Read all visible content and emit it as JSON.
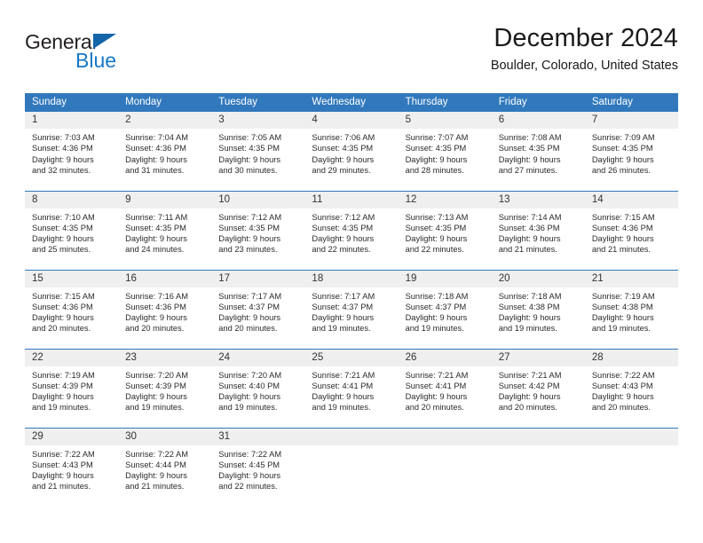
{
  "logo": {
    "word1": "General",
    "word2": "Blue",
    "triangle_color": "#1464aa",
    "blue_color": "#1878c8"
  },
  "header": {
    "title": "December 2024",
    "subtitle": "Boulder, Colorado, United States"
  },
  "theme": {
    "header_row_bg": "#3179bc",
    "daynum_bg": "#efefef",
    "grid_line": "#3179bc",
    "text": "#2b2b2b"
  },
  "weekday_headers": [
    "Sunday",
    "Monday",
    "Tuesday",
    "Wednesday",
    "Thursday",
    "Friday",
    "Saturday"
  ],
  "weeks": [
    [
      {
        "day": "1",
        "sunrise": "Sunrise: 7:03 AM",
        "sunset": "Sunset: 4:36 PM",
        "daylight1": "Daylight: 9 hours",
        "daylight2": "and 32 minutes."
      },
      {
        "day": "2",
        "sunrise": "Sunrise: 7:04 AM",
        "sunset": "Sunset: 4:36 PM",
        "daylight1": "Daylight: 9 hours",
        "daylight2": "and 31 minutes."
      },
      {
        "day": "3",
        "sunrise": "Sunrise: 7:05 AM",
        "sunset": "Sunset: 4:35 PM",
        "daylight1": "Daylight: 9 hours",
        "daylight2": "and 30 minutes."
      },
      {
        "day": "4",
        "sunrise": "Sunrise: 7:06 AM",
        "sunset": "Sunset: 4:35 PM",
        "daylight1": "Daylight: 9 hours",
        "daylight2": "and 29 minutes."
      },
      {
        "day": "5",
        "sunrise": "Sunrise: 7:07 AM",
        "sunset": "Sunset: 4:35 PM",
        "daylight1": "Daylight: 9 hours",
        "daylight2": "and 28 minutes."
      },
      {
        "day": "6",
        "sunrise": "Sunrise: 7:08 AM",
        "sunset": "Sunset: 4:35 PM",
        "daylight1": "Daylight: 9 hours",
        "daylight2": "and 27 minutes."
      },
      {
        "day": "7",
        "sunrise": "Sunrise: 7:09 AM",
        "sunset": "Sunset: 4:35 PM",
        "daylight1": "Daylight: 9 hours",
        "daylight2": "and 26 minutes."
      }
    ],
    [
      {
        "day": "8",
        "sunrise": "Sunrise: 7:10 AM",
        "sunset": "Sunset: 4:35 PM",
        "daylight1": "Daylight: 9 hours",
        "daylight2": "and 25 minutes."
      },
      {
        "day": "9",
        "sunrise": "Sunrise: 7:11 AM",
        "sunset": "Sunset: 4:35 PM",
        "daylight1": "Daylight: 9 hours",
        "daylight2": "and 24 minutes."
      },
      {
        "day": "10",
        "sunrise": "Sunrise: 7:12 AM",
        "sunset": "Sunset: 4:35 PM",
        "daylight1": "Daylight: 9 hours",
        "daylight2": "and 23 minutes."
      },
      {
        "day": "11",
        "sunrise": "Sunrise: 7:12 AM",
        "sunset": "Sunset: 4:35 PM",
        "daylight1": "Daylight: 9 hours",
        "daylight2": "and 22 minutes."
      },
      {
        "day": "12",
        "sunrise": "Sunrise: 7:13 AM",
        "sunset": "Sunset: 4:35 PM",
        "daylight1": "Daylight: 9 hours",
        "daylight2": "and 22 minutes."
      },
      {
        "day": "13",
        "sunrise": "Sunrise: 7:14 AM",
        "sunset": "Sunset: 4:36 PM",
        "daylight1": "Daylight: 9 hours",
        "daylight2": "and 21 minutes."
      },
      {
        "day": "14",
        "sunrise": "Sunrise: 7:15 AM",
        "sunset": "Sunset: 4:36 PM",
        "daylight1": "Daylight: 9 hours",
        "daylight2": "and 21 minutes."
      }
    ],
    [
      {
        "day": "15",
        "sunrise": "Sunrise: 7:15 AM",
        "sunset": "Sunset: 4:36 PM",
        "daylight1": "Daylight: 9 hours",
        "daylight2": "and 20 minutes."
      },
      {
        "day": "16",
        "sunrise": "Sunrise: 7:16 AM",
        "sunset": "Sunset: 4:36 PM",
        "daylight1": "Daylight: 9 hours",
        "daylight2": "and 20 minutes."
      },
      {
        "day": "17",
        "sunrise": "Sunrise: 7:17 AM",
        "sunset": "Sunset: 4:37 PM",
        "daylight1": "Daylight: 9 hours",
        "daylight2": "and 20 minutes."
      },
      {
        "day": "18",
        "sunrise": "Sunrise: 7:17 AM",
        "sunset": "Sunset: 4:37 PM",
        "daylight1": "Daylight: 9 hours",
        "daylight2": "and 19 minutes."
      },
      {
        "day": "19",
        "sunrise": "Sunrise: 7:18 AM",
        "sunset": "Sunset: 4:37 PM",
        "daylight1": "Daylight: 9 hours",
        "daylight2": "and 19 minutes."
      },
      {
        "day": "20",
        "sunrise": "Sunrise: 7:18 AM",
        "sunset": "Sunset: 4:38 PM",
        "daylight1": "Daylight: 9 hours",
        "daylight2": "and 19 minutes."
      },
      {
        "day": "21",
        "sunrise": "Sunrise: 7:19 AM",
        "sunset": "Sunset: 4:38 PM",
        "daylight1": "Daylight: 9 hours",
        "daylight2": "and 19 minutes."
      }
    ],
    [
      {
        "day": "22",
        "sunrise": "Sunrise: 7:19 AM",
        "sunset": "Sunset: 4:39 PM",
        "daylight1": "Daylight: 9 hours",
        "daylight2": "and 19 minutes."
      },
      {
        "day": "23",
        "sunrise": "Sunrise: 7:20 AM",
        "sunset": "Sunset: 4:39 PM",
        "daylight1": "Daylight: 9 hours",
        "daylight2": "and 19 minutes."
      },
      {
        "day": "24",
        "sunrise": "Sunrise: 7:20 AM",
        "sunset": "Sunset: 4:40 PM",
        "daylight1": "Daylight: 9 hours",
        "daylight2": "and 19 minutes."
      },
      {
        "day": "25",
        "sunrise": "Sunrise: 7:21 AM",
        "sunset": "Sunset: 4:41 PM",
        "daylight1": "Daylight: 9 hours",
        "daylight2": "and 19 minutes."
      },
      {
        "day": "26",
        "sunrise": "Sunrise: 7:21 AM",
        "sunset": "Sunset: 4:41 PM",
        "daylight1": "Daylight: 9 hours",
        "daylight2": "and 20 minutes."
      },
      {
        "day": "27",
        "sunrise": "Sunrise: 7:21 AM",
        "sunset": "Sunset: 4:42 PM",
        "daylight1": "Daylight: 9 hours",
        "daylight2": "and 20 minutes."
      },
      {
        "day": "28",
        "sunrise": "Sunrise: 7:22 AM",
        "sunset": "Sunset: 4:43 PM",
        "daylight1": "Daylight: 9 hours",
        "daylight2": "and 20 minutes."
      }
    ],
    [
      {
        "day": "29",
        "sunrise": "Sunrise: 7:22 AM",
        "sunset": "Sunset: 4:43 PM",
        "daylight1": "Daylight: 9 hours",
        "daylight2": "and 21 minutes."
      },
      {
        "day": "30",
        "sunrise": "Sunrise: 7:22 AM",
        "sunset": "Sunset: 4:44 PM",
        "daylight1": "Daylight: 9 hours",
        "daylight2": "and 21 minutes."
      },
      {
        "day": "31",
        "sunrise": "Sunrise: 7:22 AM",
        "sunset": "Sunset: 4:45 PM",
        "daylight1": "Daylight: 9 hours",
        "daylight2": "and 22 minutes."
      },
      {
        "day": "",
        "sunrise": "",
        "sunset": "",
        "daylight1": "",
        "daylight2": ""
      },
      {
        "day": "",
        "sunrise": "",
        "sunset": "",
        "daylight1": "",
        "daylight2": ""
      },
      {
        "day": "",
        "sunrise": "",
        "sunset": "",
        "daylight1": "",
        "daylight2": ""
      },
      {
        "day": "",
        "sunrise": "",
        "sunset": "",
        "daylight1": "",
        "daylight2": ""
      }
    ]
  ]
}
